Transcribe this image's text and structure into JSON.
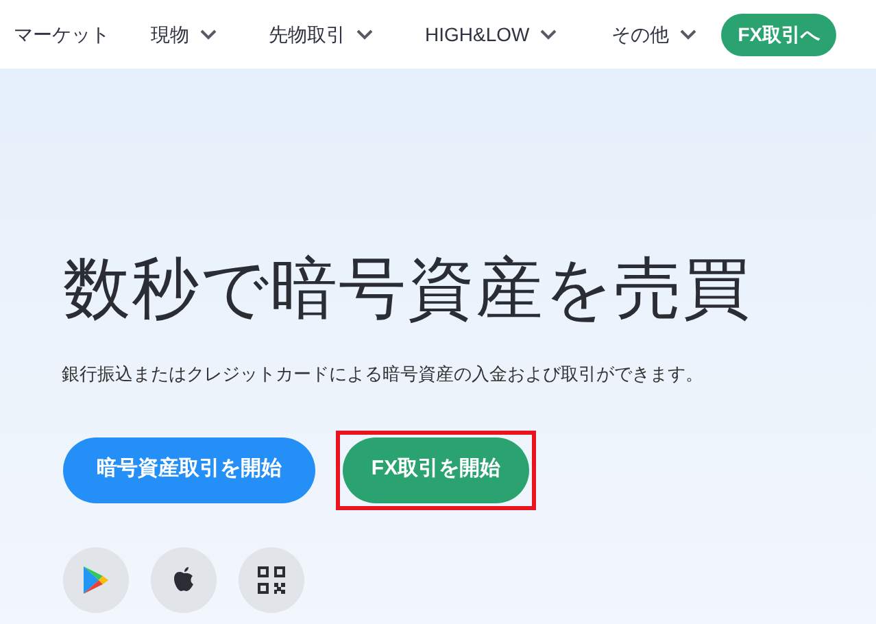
{
  "nav": {
    "items": [
      {
        "label": "マーケット",
        "dropdown": false
      },
      {
        "label": "現物",
        "dropdown": true
      },
      {
        "label": "先物取引",
        "dropdown": true
      },
      {
        "label": "HIGH&LOW",
        "dropdown": true
      },
      {
        "label": "その他",
        "dropdown": true
      }
    ],
    "cta": "FX取引へ"
  },
  "hero": {
    "title": "数秒で暗号資産を売買",
    "subtitle": "銀行振込またはクレジットカードによる暗号資産の入金および取引ができます。",
    "buttons": [
      {
        "label": "暗号資産取引を開始",
        "kind": "crypto",
        "highlighted": false
      },
      {
        "label": "FX取引を開始",
        "kind": "fx",
        "highlighted": true
      }
    ],
    "apps": [
      {
        "kind": "play"
      },
      {
        "kind": "apple"
      },
      {
        "kind": "qr"
      }
    ]
  }
}
